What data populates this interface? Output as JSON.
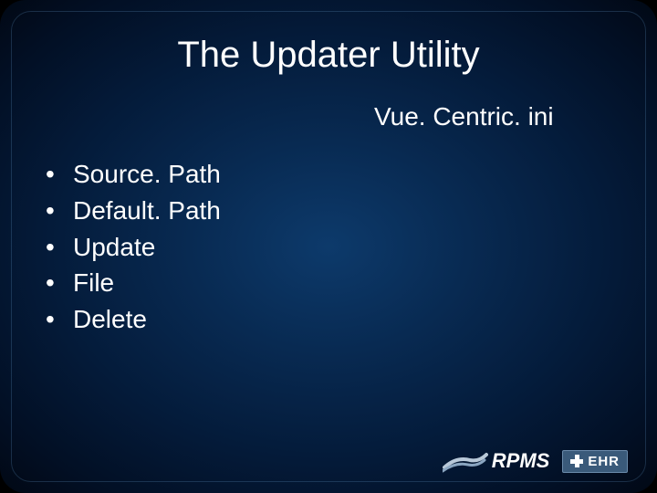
{
  "slide": {
    "title": "The Updater Utility",
    "subtitle": "Vue. Centric. ini",
    "bullets": [
      "Source. Path",
      "Default. Path",
      "Update",
      "File",
      "Delete"
    ],
    "footer": {
      "rpms_label": "RPMS",
      "ehr_label": "EHR"
    }
  }
}
